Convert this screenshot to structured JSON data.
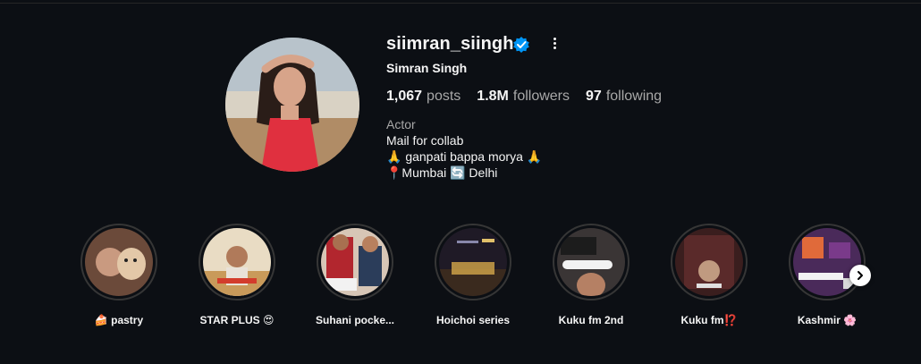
{
  "profile": {
    "username": "siimran_siingh",
    "full_name": "Simran Singh",
    "verified": true,
    "stats": {
      "posts_count": "1,067",
      "posts_label": "posts",
      "followers_count": "1.8M",
      "followers_label": "followers",
      "following_count": "97",
      "following_label": "following"
    },
    "category": "Actor",
    "bio_lines": [
      "Mail for collab",
      "🙏 ganpati bappa morya 🙏",
      "📍Mumbai 🔄 Delhi"
    ]
  },
  "highlights": [
    {
      "label": "🍰 pastry",
      "color": "#6b4a3a"
    },
    {
      "label": "STAR PLUS 😍",
      "color": "#c9a36a"
    },
    {
      "label": "Suhani pocke...",
      "color": "#8a2a2a"
    },
    {
      "label": "Hoichoi series",
      "color": "#2b2233"
    },
    {
      "label": "Kuku fm 2nd",
      "color": "#3a3030"
    },
    {
      "label": "Kuku fm⁉️",
      "color": "#5a2a2a"
    },
    {
      "label": "Kashmir 🌸",
      "color": "#5a2a6a"
    }
  ],
  "icons": {
    "verified": "verified-badge-icon",
    "more": "more-options-icon",
    "next": "chevron-right-icon"
  },
  "colors": {
    "background": "#0c0f14",
    "verified_blue": "#0095f6",
    "text_primary": "#f5f5f5",
    "text_secondary": "#a8a8a8",
    "ring": "#363636"
  }
}
